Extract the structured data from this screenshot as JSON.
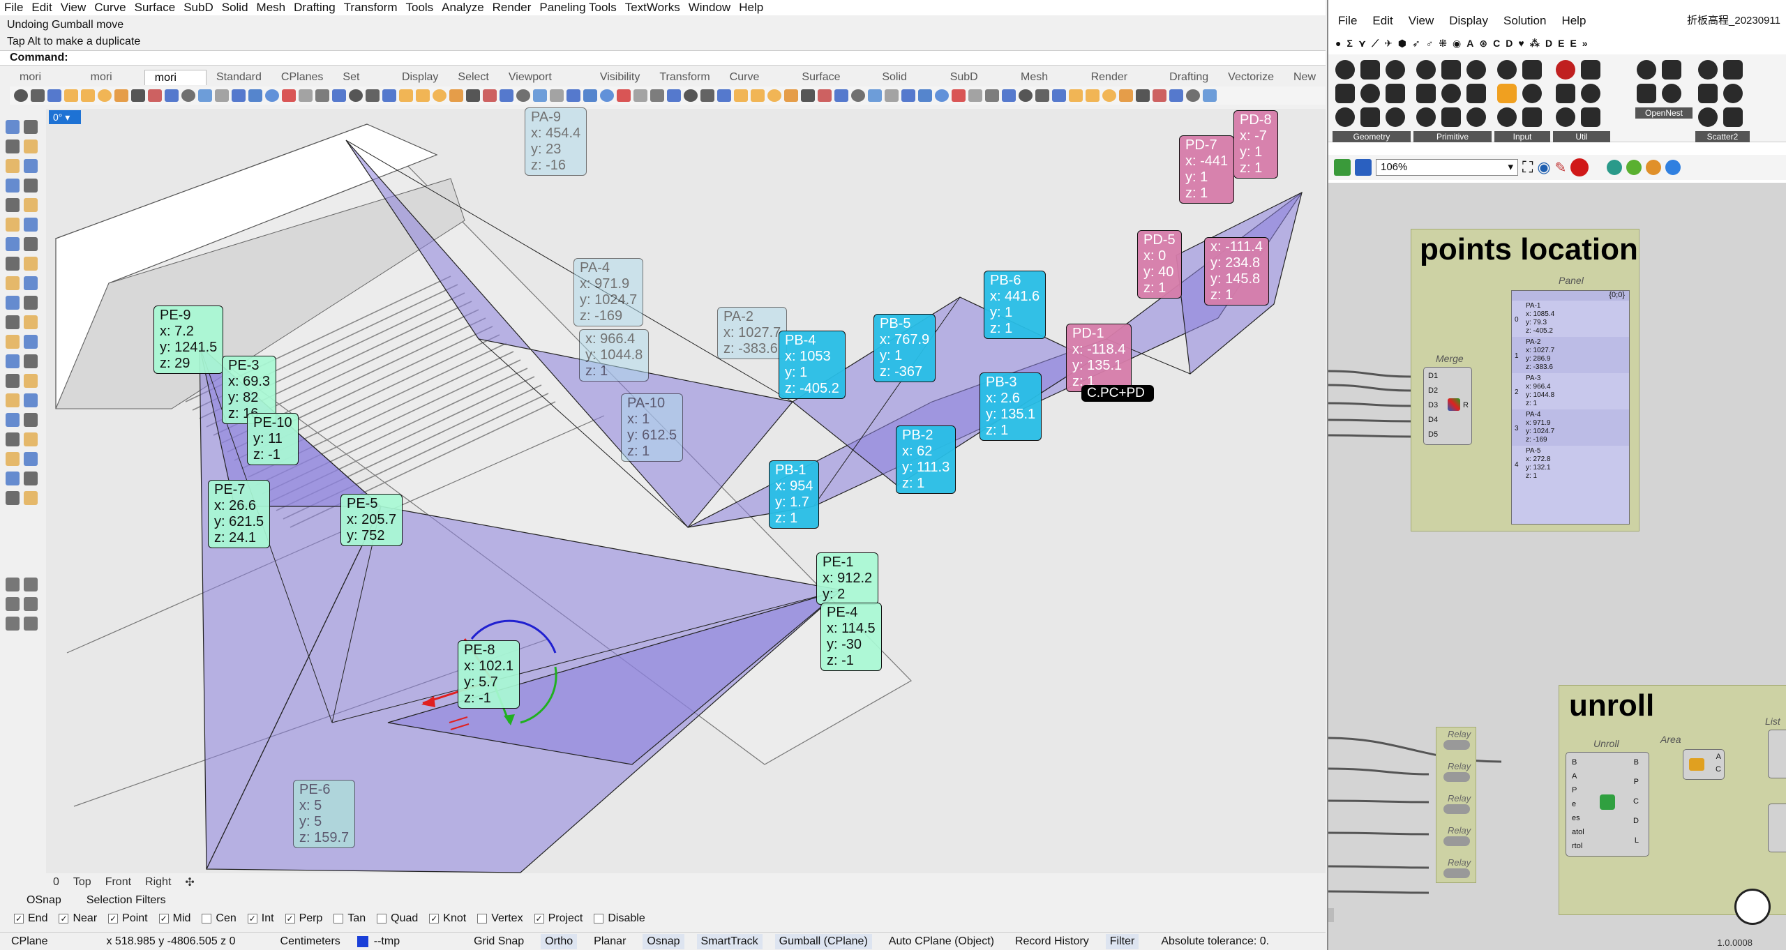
{
  "rhino": {
    "menu": [
      "File",
      "Edit",
      "View",
      "Curve",
      "Surface",
      "SubD",
      "Solid",
      "Mesh",
      "Drafting",
      "Transform",
      "Tools",
      "Analyze",
      "Render",
      "Paneling Tools",
      "TextWorks",
      "Window",
      "Help"
    ],
    "history": [
      "Undoing Gumball move",
      "Tap Alt to make a duplicate"
    ],
    "command_label": "Command:",
    "tabs": [
      "mori Popup",
      "mori GHP",
      "mori Pick",
      "Standard",
      "CPlanes",
      "Set View",
      "Display",
      "Select",
      "Viewport Layout",
      "Visibility",
      "Transform",
      "Curve Tools",
      "Surface Tools",
      "Solid Tools",
      "SubD Tools",
      "Mesh Tools",
      "Render Tools",
      "Drafting",
      "Vectorize",
      "New"
    ],
    "active_tab": "mori Pick",
    "viewport_tag": "0°",
    "view_tabs": [
      "0",
      "Top",
      "Front",
      "Right",
      "✣"
    ],
    "osnap_tabs": [
      "OSnap",
      "Selection Filters"
    ],
    "osnaps": [
      {
        "label": "End",
        "checked": true
      },
      {
        "label": "Near",
        "checked": true
      },
      {
        "label": "Point",
        "checked": true
      },
      {
        "label": "Mid",
        "checked": true
      },
      {
        "label": "Cen",
        "checked": false
      },
      {
        "label": "Int",
        "checked": true
      },
      {
        "label": "Perp",
        "checked": true
      },
      {
        "label": "Tan",
        "checked": false
      },
      {
        "label": "Quad",
        "checked": false
      },
      {
        "label": "Knot",
        "checked": true
      },
      {
        "label": "Vertex",
        "checked": false
      },
      {
        "label": "Project",
        "checked": true
      },
      {
        "label": "Disable",
        "checked": false
      }
    ],
    "status": {
      "cplane": "CPlane",
      "coords": "x 518.985  y -4806.505  z 0",
      "units": "Centimeters",
      "layer": "--tmp",
      "layer_color": "#1a3fd8",
      "toggles": [
        {
          "label": "Grid Snap",
          "on": false
        },
        {
          "label": "Ortho",
          "on": true
        },
        {
          "label": "Planar",
          "on": false
        },
        {
          "label": "Osnap",
          "on": true
        },
        {
          "label": "SmartTrack",
          "on": true
        },
        {
          "label": "Gumball (CPlane)",
          "on": true
        },
        {
          "label": "Auto CPlane (Object)",
          "on": false
        },
        {
          "label": "Record History",
          "on": false
        },
        {
          "label": "Filter",
          "on": true
        }
      ],
      "tolerance": "Absolute tolerance: 0."
    },
    "overlay_tag": "C.PC+PD"
  },
  "labels": [
    {
      "kind": "pa",
      "lines": [
        "PA-9",
        "x: 454.4",
        "y: 23",
        "z: -16"
      ]
    },
    {
      "kind": "pa",
      "lines": [
        "PA-4",
        "x: 971.9",
        "y: 1024.7",
        "z: -169"
      ]
    },
    {
      "kind": "pa",
      "lines": [
        "x: 966.4",
        "y: 1044.8",
        "z: 1"
      ]
    },
    {
      "kind": "pa",
      "lines": [
        "PA-2",
        "x: 1027.7",
        "z: -383.6"
      ]
    },
    {
      "kind": "pa",
      "lines": [
        "PA-10",
        "x: 1",
        "y: 612.5",
        "z: 1"
      ]
    },
    {
      "kind": "pb",
      "lines": [
        "PB-4",
        "x: 1053",
        "y: 1",
        "z: -405.2"
      ]
    },
    {
      "kind": "pb",
      "lines": [
        "PB-5",
        "x: 767.9",
        "y: 1",
        "z: -367"
      ]
    },
    {
      "kind": "pb",
      "lines": [
        "PB-6",
        "x: 441.6",
        "y: 1",
        "z: 1"
      ]
    },
    {
      "kind": "pb",
      "lines": [
        "PB-3",
        "x: 2.6",
        "y: 135.1",
        "z: 1"
      ]
    },
    {
      "kind": "pb",
      "lines": [
        "PB-2",
        "x: 62",
        "y: 111.3",
        "z: 1"
      ]
    },
    {
      "kind": "pb",
      "lines": [
        "PB-1",
        "x: 954",
        "y: 1.7",
        "z: 1"
      ]
    },
    {
      "kind": "pd",
      "lines": [
        "PD-7",
        "x: -441",
        "y: 1",
        "z: 1"
      ]
    },
    {
      "kind": "pd",
      "lines": [
        "PD-8",
        "x: -7",
        "y: 1",
        "z: 1"
      ]
    },
    {
      "kind": "pd",
      "lines": [
        "PD-5",
        "x: 0",
        "y: 40",
        "z: 1"
      ]
    },
    {
      "kind": "pd",
      "lines": [
        "PD-1",
        "x: -118.4",
        "y: 135.1",
        "z: 1"
      ]
    },
    {
      "kind": "pd",
      "lines": [
        "x: -111.4",
        "y: 234.8",
        "y: 145.8",
        "z: 1"
      ]
    },
    {
      "kind": "pe",
      "lines": [
        "PE-9",
        "x: 7.2",
        "y: 1241.5",
        "z: 29"
      ]
    },
    {
      "kind": "pe",
      "lines": [
        "PE-3",
        "x: 69.3",
        "y: 82",
        "z: 16"
      ]
    },
    {
      "kind": "pe",
      "lines": [
        "PE-10",
        "y: 11",
        "z: -1"
      ]
    },
    {
      "kind": "pe",
      "lines": [
        "PE-7",
        "x: 26.6",
        "y: 621.5",
        "z: 24.1"
      ]
    },
    {
      "kind": "pe",
      "lines": [
        "PE-5",
        "x: 205.7",
        "y: 752"
      ]
    },
    {
      "kind": "pe",
      "lines": [
        "PE-1",
        "x: 912.2",
        "y: 2"
      ]
    },
    {
      "kind": "pe",
      "lines": [
        "PE-4",
        "x: 114.5",
        "y: -30",
        "z: -1"
      ]
    },
    {
      "kind": "pe",
      "lines": [
        "PE-8",
        "x: 102.1",
        "y: 5.7",
        "z: -1"
      ]
    },
    {
      "kind": "pe",
      "lines": [
        "PE-6",
        "x: 5",
        "y: 5",
        "z: 159.7"
      ]
    }
  ],
  "gh": {
    "menu": [
      "File",
      "Edit",
      "View",
      "Display",
      "Solution",
      "Help"
    ],
    "doc_title": "折板高程_20230911",
    "categories": [
      "●",
      "Σ",
      "⋎",
      "⟋",
      "✈",
      "⬢",
      "➶",
      "♂",
      "⁜",
      "◉",
      "A",
      "⊛",
      "C",
      "D",
      "♥",
      "⁂",
      "D",
      "E",
      "E",
      "»"
    ],
    "palette_groups": [
      "Geometry",
      "Primitive",
      "Input",
      "Util",
      "OpenNest",
      "Scatter2"
    ],
    "zoom": "106%",
    "group_points_title": "points location",
    "group_unroll_title": "unroll",
    "merge_label": "Merge",
    "merge_inputs": [
      "D1",
      "D2",
      "D3",
      "D4",
      "D5"
    ],
    "merge_output": "R",
    "panel_label": "Panel",
    "panel_path": "{0;0}",
    "panel_rows": [
      {
        "idx": "0",
        "text": [
          "PA-1",
          "x: 1085.4",
          "y: 79.3",
          "z: -405.2"
        ]
      },
      {
        "idx": "1",
        "text": [
          "PA-2",
          "x: 1027.7",
          "y: 286.9",
          "z: -383.6"
        ]
      },
      {
        "idx": "2",
        "text": [
          "PA-3",
          "x: 966.4",
          "y: 1044.8",
          "z: 1"
        ]
      },
      {
        "idx": "3",
        "text": [
          "PA-4",
          "x: 971.9",
          "y: 1024.7",
          "z: -169"
        ]
      },
      {
        "idx": "4",
        "text": [
          "PA-5",
          "x: 272.8",
          "y: 132.1",
          "z: 1"
        ]
      }
    ],
    "relay_label": "Relay",
    "unroll_label": "Unroll",
    "unroll_inputs": [
      "B",
      "A",
      "P",
      "e",
      "es",
      "atol",
      "rtol"
    ],
    "unroll_outputs": [
      "B",
      "P",
      "C",
      "D",
      "L"
    ],
    "area_label": "Area",
    "area_outputs": [
      "A",
      "C"
    ],
    "list_label": "List",
    "version": "1.0.0008"
  }
}
